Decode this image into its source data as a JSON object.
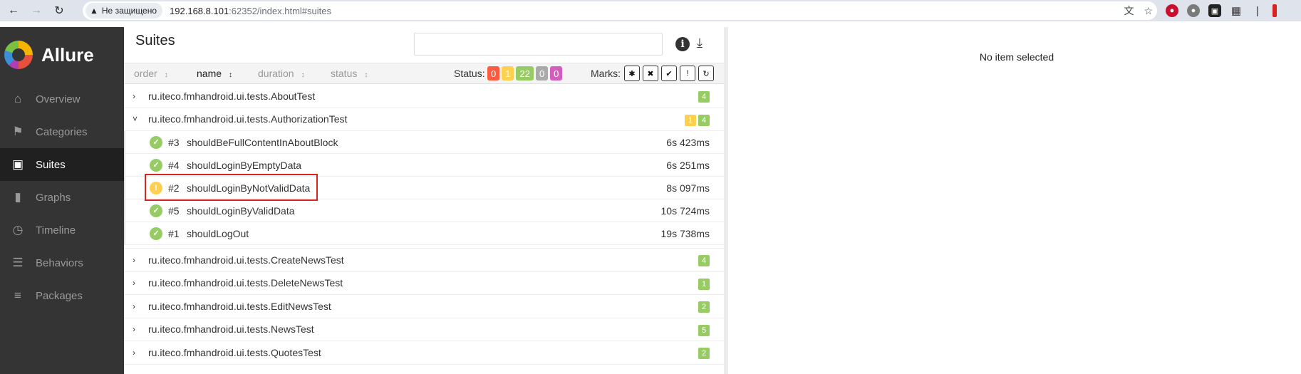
{
  "browser": {
    "security_label": "Не защищено",
    "url_host": "192.168.8.101",
    "url_rest": ":62352/index.html#suites"
  },
  "sidebar": {
    "brand": "Allure",
    "items": [
      {
        "label": "Overview",
        "icon": "home-icon"
      },
      {
        "label": "Categories",
        "icon": "flag-icon"
      },
      {
        "label": "Suites",
        "icon": "briefcase-icon",
        "active": true
      },
      {
        "label": "Graphs",
        "icon": "bar-chart-icon"
      },
      {
        "label": "Timeline",
        "icon": "clock-icon"
      },
      {
        "label": "Behaviors",
        "icon": "list-icon"
      },
      {
        "label": "Packages",
        "icon": "align-left-icon"
      }
    ]
  },
  "suites_pane": {
    "title": "Suites",
    "search_value": "",
    "sort": {
      "order": "order",
      "name": "name",
      "duration": "duration",
      "status": "status"
    },
    "status_label": "Status:",
    "status_counts": [
      {
        "value": "0",
        "color": "#fd5a3e"
      },
      {
        "value": "1",
        "color": "#ffd050"
      },
      {
        "value": "22",
        "color": "#97cc64"
      },
      {
        "value": "0",
        "color": "#aaaaaa"
      },
      {
        "value": "0",
        "color": "#d35ebe"
      }
    ],
    "marks_label": "Marks:",
    "marks": [
      "flaky-icon",
      "new-failed-icon",
      "new-passed-icon",
      "new-broken-icon",
      "retries-icon"
    ],
    "suites": [
      {
        "name": "ru.iteco.fmhandroid.ui.tests.AboutTest",
        "expanded": false,
        "counts": [
          {
            "v": "4",
            "c": "#97cc64"
          }
        ]
      },
      {
        "name": "ru.iteco.fmhandroid.ui.tests.AuthorizationTest",
        "expanded": true,
        "counts": [
          {
            "v": "1",
            "c": "#ffd050"
          },
          {
            "v": "4",
            "c": "#97cc64"
          }
        ],
        "tests": [
          {
            "num": "#3",
            "name": "shouldBeFullContentInAboutBlock",
            "duration": "6s 423ms",
            "status": "passed"
          },
          {
            "num": "#4",
            "name": "shouldLoginByEmptyData",
            "duration": "6s 251ms",
            "status": "passed"
          },
          {
            "num": "#2",
            "name": "shouldLoginByNotValidData",
            "duration": "8s 097ms",
            "status": "broken"
          },
          {
            "num": "#5",
            "name": "shouldLoginByValidData",
            "duration": "10s 724ms",
            "status": "passed"
          },
          {
            "num": "#1",
            "name": "shouldLogOut",
            "duration": "19s 738ms",
            "status": "passed"
          }
        ]
      },
      {
        "name": "ru.iteco.fmhandroid.ui.tests.CreateNewsTest",
        "expanded": false,
        "counts": [
          {
            "v": "4",
            "c": "#97cc64"
          }
        ]
      },
      {
        "name": "ru.iteco.fmhandroid.ui.tests.DeleteNewsTest",
        "expanded": false,
        "counts": [
          {
            "v": "1",
            "c": "#97cc64"
          }
        ]
      },
      {
        "name": "ru.iteco.fmhandroid.ui.tests.EditNewsTest",
        "expanded": false,
        "counts": [
          {
            "v": "2",
            "c": "#97cc64"
          }
        ]
      },
      {
        "name": "ru.iteco.fmhandroid.ui.tests.NewsTest",
        "expanded": false,
        "counts": [
          {
            "v": "5",
            "c": "#97cc64"
          }
        ]
      },
      {
        "name": "ru.iteco.fmhandroid.ui.tests.QuotesTest",
        "expanded": false,
        "counts": [
          {
            "v": "2",
            "c": "#97cc64"
          }
        ]
      }
    ]
  },
  "detail_pane": {
    "empty_message": "No item selected"
  },
  "colors": {
    "passed": "#97cc64",
    "broken": "#ffd050",
    "highlight": "#d9231f"
  }
}
